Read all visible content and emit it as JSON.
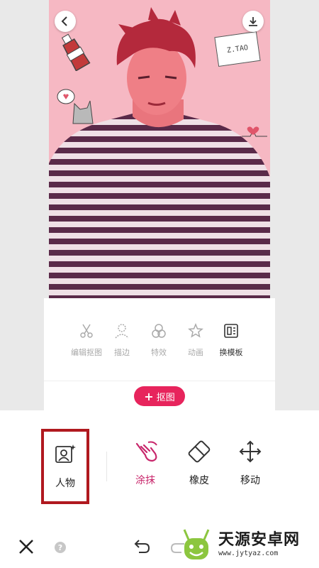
{
  "top_controls": {
    "back_icon": "chevron-left-icon",
    "download_icon": "download-icon"
  },
  "stickers": {
    "note_text": "Z.TAO"
  },
  "edit_tools": [
    {
      "label": "编辑抠图",
      "icon": "scissors-icon",
      "active": false
    },
    {
      "label": "描边",
      "icon": "person-outline-icon",
      "active": false
    },
    {
      "label": "特效",
      "icon": "circles-icon",
      "active": false
    },
    {
      "label": "动画",
      "icon": "star-icon",
      "active": false
    },
    {
      "label": "换模板",
      "icon": "template-icon",
      "active": true
    }
  ],
  "add_button": {
    "plus": "+",
    "label": "抠图",
    "color": "#e7245c"
  },
  "brush_tools": [
    {
      "label": "人物",
      "icon": "portrait-icon",
      "selected": true
    },
    {
      "label": "涂抹",
      "icon": "hand-swipe-icon",
      "active": true,
      "color": "#c8266b"
    },
    {
      "label": "橡皮",
      "icon": "eraser-icon"
    },
    {
      "label": "移动",
      "icon": "move-arrows-icon"
    }
  ],
  "bottom_bar": {
    "help_text": "?"
  },
  "watermark": {
    "title": "天源安卓网",
    "url": "www.jytyaz.com"
  }
}
